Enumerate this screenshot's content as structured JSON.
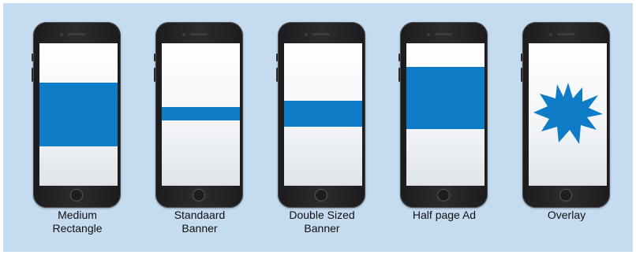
{
  "colors": {
    "background": "#c5dbef",
    "ad_fill": "#0e7cc7",
    "phone_body": "#1c1c1e"
  },
  "formats": [
    {
      "id": "medium-rectangle",
      "label_lines": [
        "Medium",
        "Rectangle"
      ]
    },
    {
      "id": "standard-banner",
      "label_lines": [
        "Standaard",
        "Banner"
      ]
    },
    {
      "id": "double-sized-banner",
      "label_lines": [
        "Double Sized",
        "Banner"
      ]
    },
    {
      "id": "half-page-ad",
      "label_lines": [
        "Half page Ad",
        ""
      ]
    },
    {
      "id": "overlay",
      "label_lines": [
        "Overlay",
        ""
      ]
    }
  ]
}
